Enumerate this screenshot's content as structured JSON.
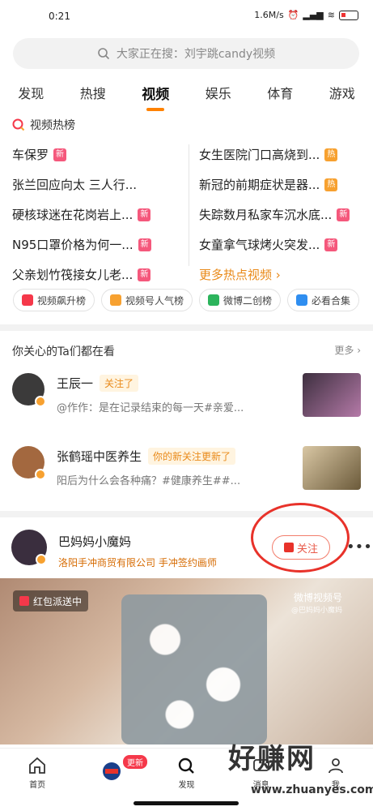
{
  "status": {
    "time": "0:21",
    "net": "1.6M/s",
    "battery": "19"
  },
  "search": {
    "placeholder": "大家正在搜：刘宇跳candy视频"
  },
  "tabs": [
    {
      "label": "发现"
    },
    {
      "label": "热搜"
    },
    {
      "label": "视频",
      "active": true
    },
    {
      "label": "娱乐"
    },
    {
      "label": "体育"
    },
    {
      "label": "游戏"
    }
  ],
  "hot": {
    "header": "视频热榜",
    "left": [
      {
        "text": "车保罗",
        "badge": "新"
      },
      {
        "text": "张兰回应向太 三人行...",
        "badge": ""
      },
      {
        "text": "硬核球迷在花岗岩上...",
        "badge": "新"
      },
      {
        "text": "N95口罩价格为何一...",
        "badge": "新"
      },
      {
        "text": "父亲划竹筏接女儿老...",
        "badge": "新"
      }
    ],
    "right": [
      {
        "text": "女生医院门口高烧到...",
        "badge": "热"
      },
      {
        "text": "新冠的前期症状是器...",
        "badge": "热"
      },
      {
        "text": "失踪数月私家车沉水底...",
        "badge": "新"
      },
      {
        "text": "女童拿气球烤火突发...",
        "badge": "新"
      }
    ],
    "more": "更多热点视频 ›"
  },
  "chips": [
    {
      "label": "视频飙升榜",
      "color": "#f5384a"
    },
    {
      "label": "视频号人气榜",
      "color": "#f7a130"
    },
    {
      "label": "微博二创榜",
      "color": "#2cb45c"
    },
    {
      "label": "必看合集",
      "color": "#2f8ef0"
    }
  ],
  "follow": {
    "title": "你关心的Ta们都在看",
    "more": "更多 ›",
    "rows": [
      {
        "name": "王辰一",
        "tag": "关注了",
        "desc": "@作作：是在记录结束的每一天#亲爱...",
        "thumb": "#5a4a5a"
      },
      {
        "name": "张鹤瑶中医养生",
        "tag": "你的新关注更新了",
        "desc": "阳后为什么会各种痛？#健康养生##...",
        "thumb": "#c9b28a"
      }
    ]
  },
  "post": {
    "name": "巴妈妈小魔妈",
    "desc": "洛阳手冲商贸有限公司 手冲签约画师",
    "follow_label": "关注",
    "redpacket": "红包派送中",
    "watermark": "微博视频号",
    "watermark_sub": "@巴妈妈小魔妈"
  },
  "nav": [
    {
      "label": "首页",
      "icon": "home-icon"
    },
    {
      "label": "",
      "icon": "avatar-icon"
    },
    {
      "label": "发现",
      "icon": "discover-icon"
    },
    {
      "label": "消息",
      "icon": "message-icon"
    },
    {
      "label": "我",
      "icon": "me-icon"
    }
  ],
  "nav_update": "更新",
  "logo": {
    "text": "好赚网",
    "url": "www.zhuanyes.com"
  }
}
